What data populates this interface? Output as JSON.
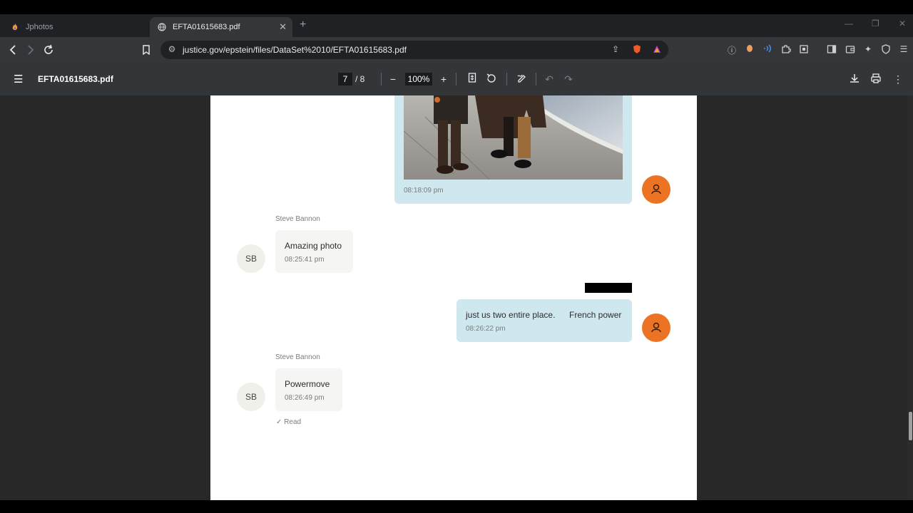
{
  "browser": {
    "tabs": [
      {
        "title": "Jphotos",
        "active": false
      },
      {
        "title": "EFTA01615683.pdf",
        "active": true
      }
    ],
    "address": "justice.gov/epstein/files/DataSet%2010/EFTA01615683.pdf"
  },
  "pdf_toolbar": {
    "filename": "EFTA01615683.pdf",
    "current_page": "7",
    "page_total": "/ 8",
    "zoom": "100%"
  },
  "chat": {
    "photo_message": {
      "time": "08:18:09 pm"
    },
    "messages": [
      {
        "sender": "Steve Bannon",
        "initials": "SB",
        "text": "Amazing photo",
        "time": "08:25:41 pm"
      },
      {
        "text_part1": "just us two entire place.",
        "text_part2": "French power",
        "time": "08:26:22 pm"
      },
      {
        "sender": "Steve Bannon",
        "initials": "SB",
        "text": "Powermove",
        "time": "08:26:49 pm"
      }
    ],
    "read_status": "Read"
  },
  "colors": {
    "outgoing_bubble": "#cfe7ee",
    "incoming_bubble": "#f5f5f3",
    "user_avatar": "#ec7324"
  }
}
